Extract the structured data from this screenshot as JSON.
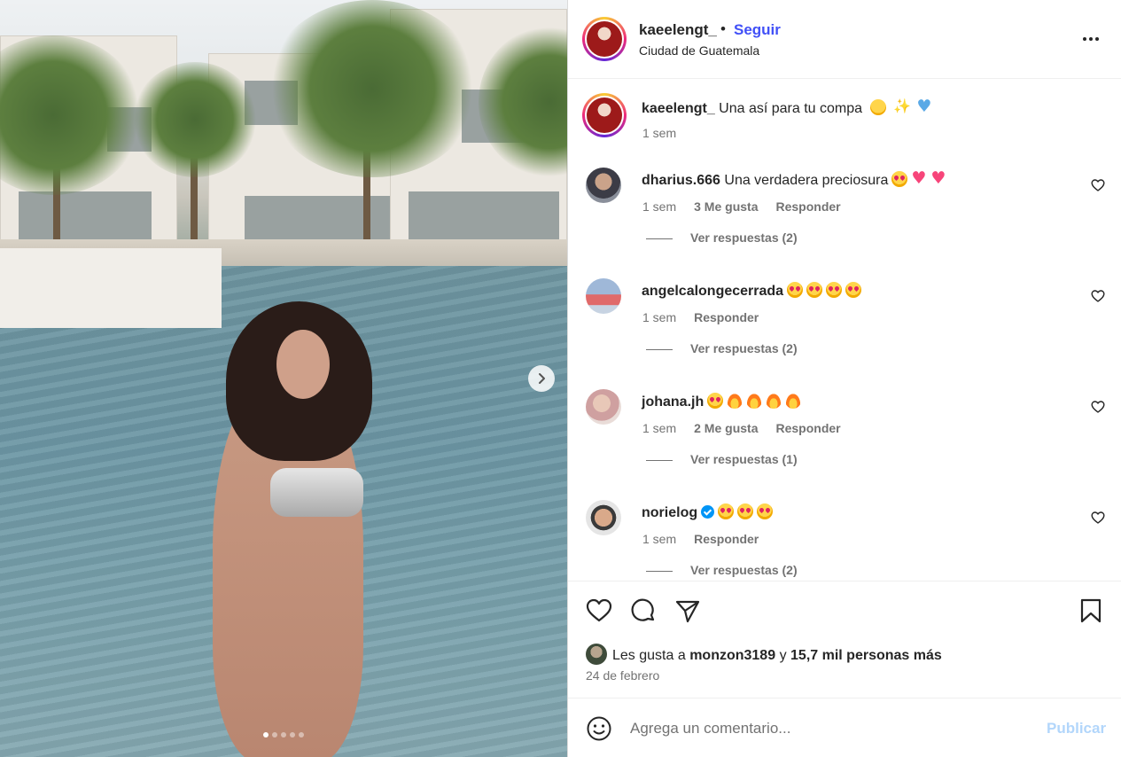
{
  "header": {
    "username": "kaeelengt_",
    "separator": "•",
    "follow_label": "Seguir",
    "location": "Ciudad de Guatemala",
    "more_icon": "more-horizontal-icon"
  },
  "caption": {
    "username": "kaeelengt_",
    "text": "Una así para tu compa",
    "emojis": [
      "smiling-blush",
      "sparkles",
      "blue-heart"
    ],
    "time": "1 sem"
  },
  "comments": [
    {
      "username": "dharius.666",
      "text": "Una verdadera preciosura",
      "emojis": [
        "heart-eyes",
        "pink-heart",
        "pink-heart"
      ],
      "verified": false,
      "time": "1 sem",
      "likes": "3 Me gusta",
      "reply_label": "Responder",
      "view_replies": "Ver respuestas (2)"
    },
    {
      "username": "angelcalongecerrada",
      "text": "",
      "emojis": [
        "heart-eyes",
        "heart-eyes",
        "heart-eyes",
        "heart-eyes"
      ],
      "verified": false,
      "time": "1 sem",
      "likes": "",
      "reply_label": "Responder",
      "view_replies": "Ver respuestas (2)"
    },
    {
      "username": "johana.jh",
      "text": "",
      "emojis": [
        "heart-eyes",
        "fire",
        "fire",
        "fire",
        "fire"
      ],
      "verified": false,
      "time": "1 sem",
      "likes": "2 Me gusta",
      "reply_label": "Responder",
      "view_replies": "Ver respuestas (1)"
    },
    {
      "username": "norielog",
      "text": "",
      "emojis": [
        "heart-eyes",
        "heart-eyes",
        "heart-eyes"
      ],
      "verified": true,
      "time": "1 sem",
      "likes": "",
      "reply_label": "Responder",
      "view_replies": "Ver respuestas (2)"
    }
  ],
  "likes_line": {
    "prefix": "Les gusta a",
    "user": "monzon3189",
    "joiner": "y",
    "others": "15,7 mil personas más"
  },
  "date": "24 de febrero",
  "composer": {
    "placeholder": "Agrega un comentario...",
    "publish_label": "Publicar"
  },
  "carousel": {
    "total": 5,
    "current": 1
  },
  "colors": {
    "follow_blue": "#4150f7",
    "publish_disabled": "#b2d6fb",
    "muted_text": "#737373",
    "verified_blue": "#0095f6"
  }
}
